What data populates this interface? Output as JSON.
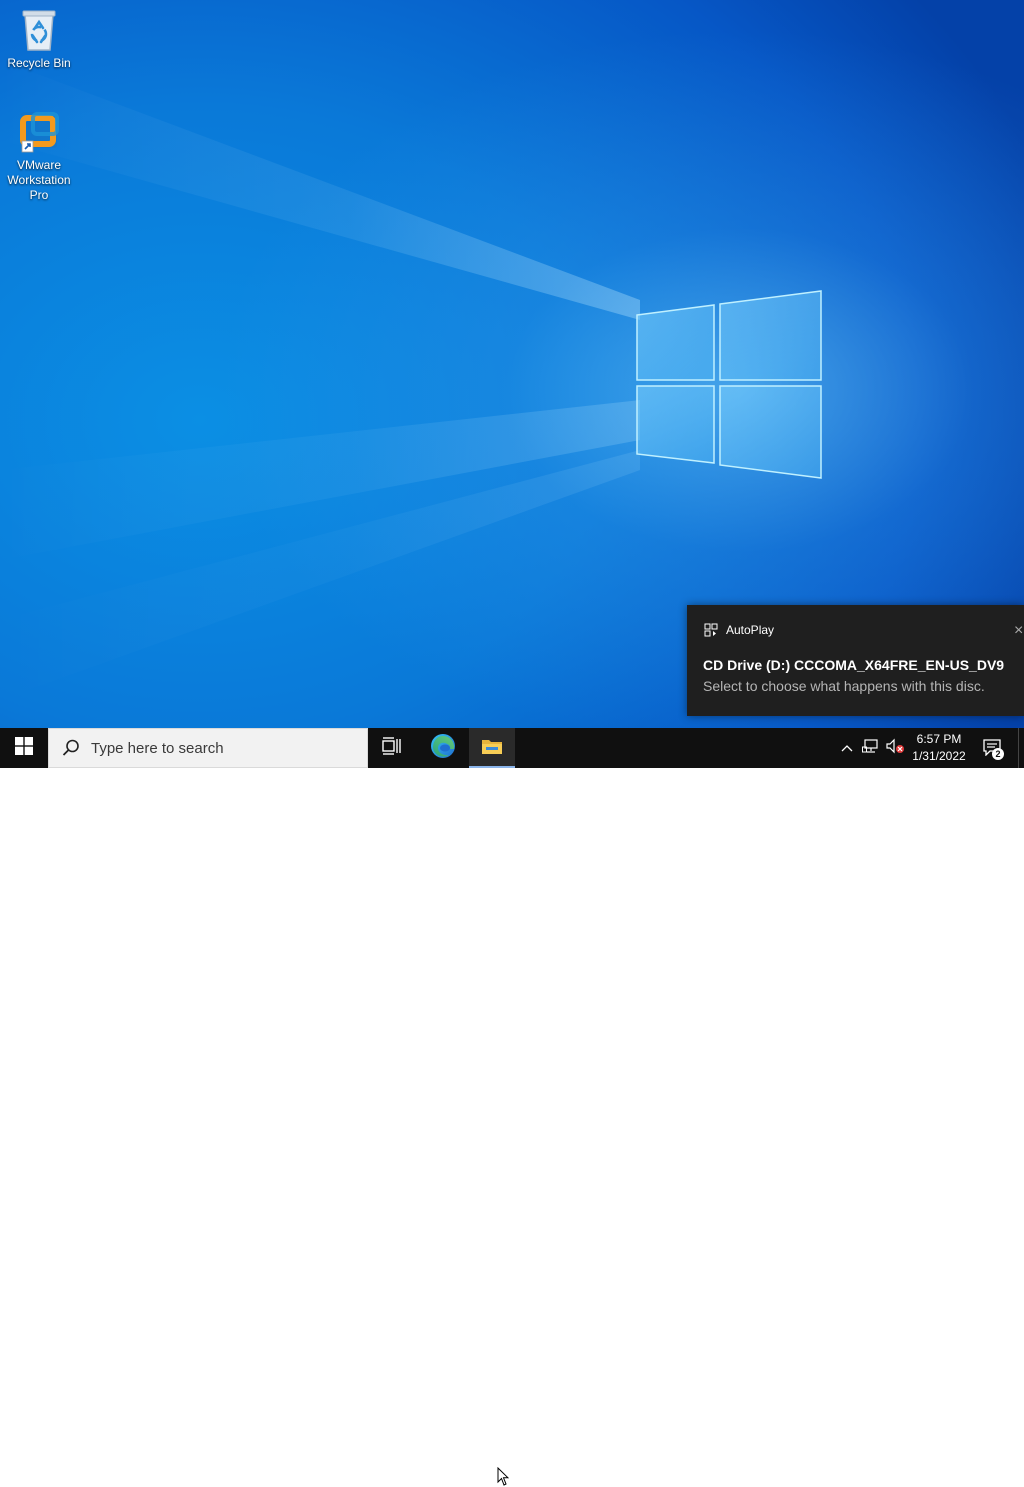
{
  "desktop": {
    "icons": [
      {
        "label": "Recycle Bin",
        "icon": "recycle-bin-icon"
      },
      {
        "label": "VMware Workstation Pro",
        "icon": "vmware-workstation-icon",
        "shortcut": true
      }
    ],
    "wallpaper": "windows-10-logo-light-beam",
    "colors": {
      "wallpaper_primary": "#0a79d8",
      "wallpaper_dark": "#0441a8",
      "logo_glow": "#8fdcff"
    }
  },
  "toast": {
    "app_name": "AutoPlay",
    "app_icon": "autoplay-icon",
    "title": "CD Drive (D:) CCCOMA_X64FRE_EN-US_DV9",
    "body": "Select to choose what happens with this disc.",
    "close_glyph": "×",
    "colors": {
      "background": "#1f1f1f",
      "body_text": "#b5b5b5"
    }
  },
  "taskbar": {
    "start_icon": "windows-start-icon",
    "search_placeholder": "Type here to search",
    "search_value": "",
    "pinned": [
      {
        "name": "Task View",
        "icon": "task-view-icon"
      },
      {
        "name": "Microsoft Edge",
        "icon": "edge-icon"
      },
      {
        "name": "File Explorer",
        "icon": "file-explorer-icon",
        "active": true
      }
    ],
    "tray": {
      "chevron_glyph": "^",
      "network_icon": "network-icon",
      "volume_icon": "volume-muted-icon",
      "time": "6:57 PM",
      "date": "1/31/2022",
      "notifications_count": "2"
    },
    "colors": {
      "background": "#101010",
      "search_bg": "#f2f2f2",
      "active_underline": "#8ab4ea"
    }
  }
}
